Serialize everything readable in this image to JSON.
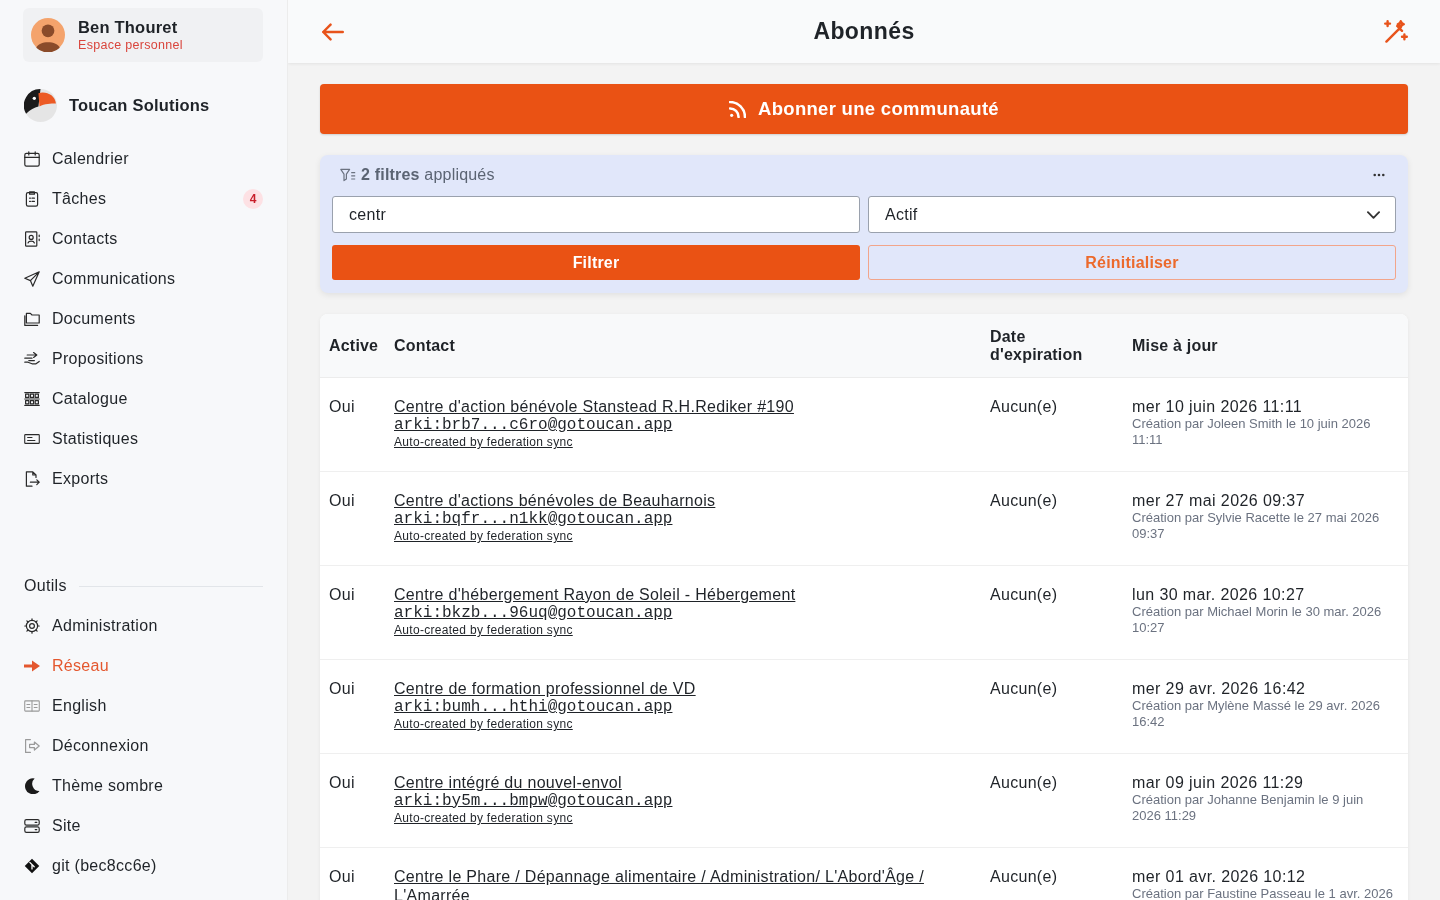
{
  "sidebar": {
    "user": {
      "name": "Ben Thouret",
      "subtitle": "Espace personnel"
    },
    "organization": {
      "name": "Toucan Solutions"
    },
    "items": [
      {
        "label": "Calendrier",
        "selected": false
      },
      {
        "label": "Tâches",
        "selected": false,
        "badge": "4"
      },
      {
        "label": "Contacts",
        "selected": false
      },
      {
        "label": "Communications",
        "selected": false
      },
      {
        "label": "Documents",
        "selected": false
      },
      {
        "label": "Propositions",
        "selected": false
      },
      {
        "label": "Catalogue",
        "selected": false
      },
      {
        "label": "Statistiques",
        "selected": false
      },
      {
        "label": "Exports",
        "selected": false
      }
    ],
    "tools": {
      "title": "Outils",
      "items": [
        {
          "label": "Administration",
          "selected": false
        },
        {
          "label": "Réseau",
          "selected": true
        },
        {
          "label": "English",
          "selected": false
        },
        {
          "label": "Déconnexion",
          "selected": false
        },
        {
          "label": "Thème sombre",
          "selected": false
        },
        {
          "label": "Site",
          "selected": false
        },
        {
          "label": "git (bec8cc6e)",
          "selected": false
        }
      ]
    }
  },
  "header": {
    "title": "Abonnés"
  },
  "subscribe_button": {
    "label": "Abonner une communauté"
  },
  "filters": {
    "summary": "**2 filtres** appliqués",
    "search": {
      "value": "centr"
    },
    "status": {
      "value": "Actif"
    },
    "buttons": [
      {
        "label": "Filtrer",
        "kind": "primary"
      },
      {
        "label": "Réinitialiser",
        "kind": "secondary"
      }
    ]
  },
  "table": {
    "columns": [
      "Active",
      "Contact",
      "Date d'expiration",
      "Mise à jour"
    ],
    "rows": [
      {
        "active": "Oui",
        "contact": "Centre d'action bénévole Stanstead R.H.Rediker #190",
        "address": "arki:brb7...c6ro@gotoucan.app",
        "note": "Auto-created by federation sync",
        "expiration": "Aucun(e)",
        "updated": "mer 10 juin 2026 11:11",
        "created": "Création par Joleen Smith le 10 juin 2026 11:11"
      },
      {
        "active": "Oui",
        "contact": "Centre d'actions bénévoles de Beauharnois",
        "address": "arki:bqfr...n1kk@gotoucan.app",
        "note": "Auto-created by federation sync",
        "expiration": "Aucun(e)",
        "updated": "mer 27 mai 2026 09:37",
        "created": "Création par Sylvie Racette le 27 mai 2026 09:37"
      },
      {
        "active": "Oui",
        "contact": "Centre d'hébergement Rayon de Soleil - Hébergement",
        "address": "arki:bkzb...96uq@gotoucan.app",
        "note": "Auto-created by federation sync",
        "expiration": "Aucun(e)",
        "updated": "lun 30 mar. 2026 10:27",
        "created": "Création par Michael Morin le 30 mar. 2026 10:27"
      },
      {
        "active": "Oui",
        "contact": "Centre de formation professionnel de VD",
        "address": "arki:bumh...hthi@gotoucan.app",
        "note": "Auto-created by federation sync",
        "expiration": "Aucun(e)",
        "updated": "mer 29 avr. 2026 16:42",
        "created": "Création par Mylène Massé le 29 avr. 2026 16:42"
      },
      {
        "active": "Oui",
        "contact": "Centre intégré du nouvel-envol",
        "address": "arki:by5m...bmpw@gotoucan.app",
        "note": "Auto-created by federation sync",
        "expiration": "Aucun(e)",
        "updated": "mar 09 juin 2026 11:29",
        "created": "Création par Johanne Benjamin le 9 juin 2026 11:29"
      },
      {
        "active": "Oui",
        "contact": "Centre le Phare / Dépannage alimentaire / Administration/ L'Abord'Âge / L'Amarrée",
        "expiration": "Aucun(e)",
        "updated": "mer 01 avr. 2026 10:12",
        "created": "Création par Faustine Passeau le 1 avr. 2026"
      }
    ]
  }
}
